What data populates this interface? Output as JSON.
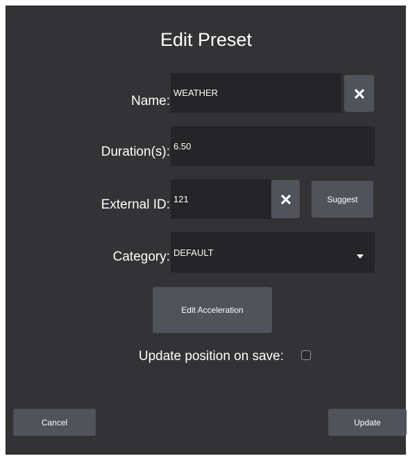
{
  "dialog": {
    "title": "Edit Preset"
  },
  "name": {
    "label": "Name:",
    "value": "WEATHER",
    "clear_icon": "close-icon"
  },
  "duration": {
    "label": "Duration(s):",
    "value": "6.50"
  },
  "external_id": {
    "label": "External ID:",
    "value": "121",
    "clear_icon": "close-icon",
    "suggest_label": "Suggest"
  },
  "category": {
    "label": "Category:",
    "value": "DEFAULT",
    "dropdown_icon": "caret-down-icon"
  },
  "edit_acceleration_label": "Edit Acceleration",
  "update_position": {
    "label": "Update position on save:",
    "checked": false
  },
  "footer": {
    "cancel_label": "Cancel",
    "update_label": "Update"
  },
  "colors": {
    "background": "#333336",
    "field": "#252527",
    "button": "#50535a",
    "text": "#ffffff"
  }
}
